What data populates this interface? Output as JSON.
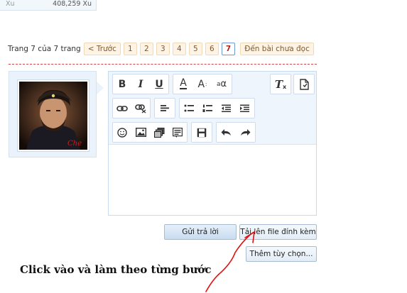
{
  "stats": {
    "label": "Xu",
    "value": "408,259 Xu"
  },
  "pagination": {
    "info": "Trang 7 của 7 trang",
    "prev_label": "< Trước",
    "pages": [
      "1",
      "2",
      "3",
      "4",
      "5",
      "6"
    ],
    "current": "7",
    "unread_label": "Đến bài chưa đọc"
  },
  "toolbar": {
    "bold": "B",
    "italic": "I",
    "underline": "U",
    "font_color": "A",
    "font_size": "A",
    "font_size_small": "a",
    "text_color_small": "α",
    "remove_format": "T"
  },
  "actions": {
    "submit_label": "Gửi trả lời",
    "upload_label": "Tải lên file đính kèm",
    "more_label": "Thêm tùy chọn..."
  },
  "annotation": "Click vào và làm theo từng bước",
  "colors": {
    "accent_red": "#b42318",
    "pager_bg": "#fff3e3",
    "panel_bg": "#eaf3fb",
    "arrow": "#e01010"
  }
}
